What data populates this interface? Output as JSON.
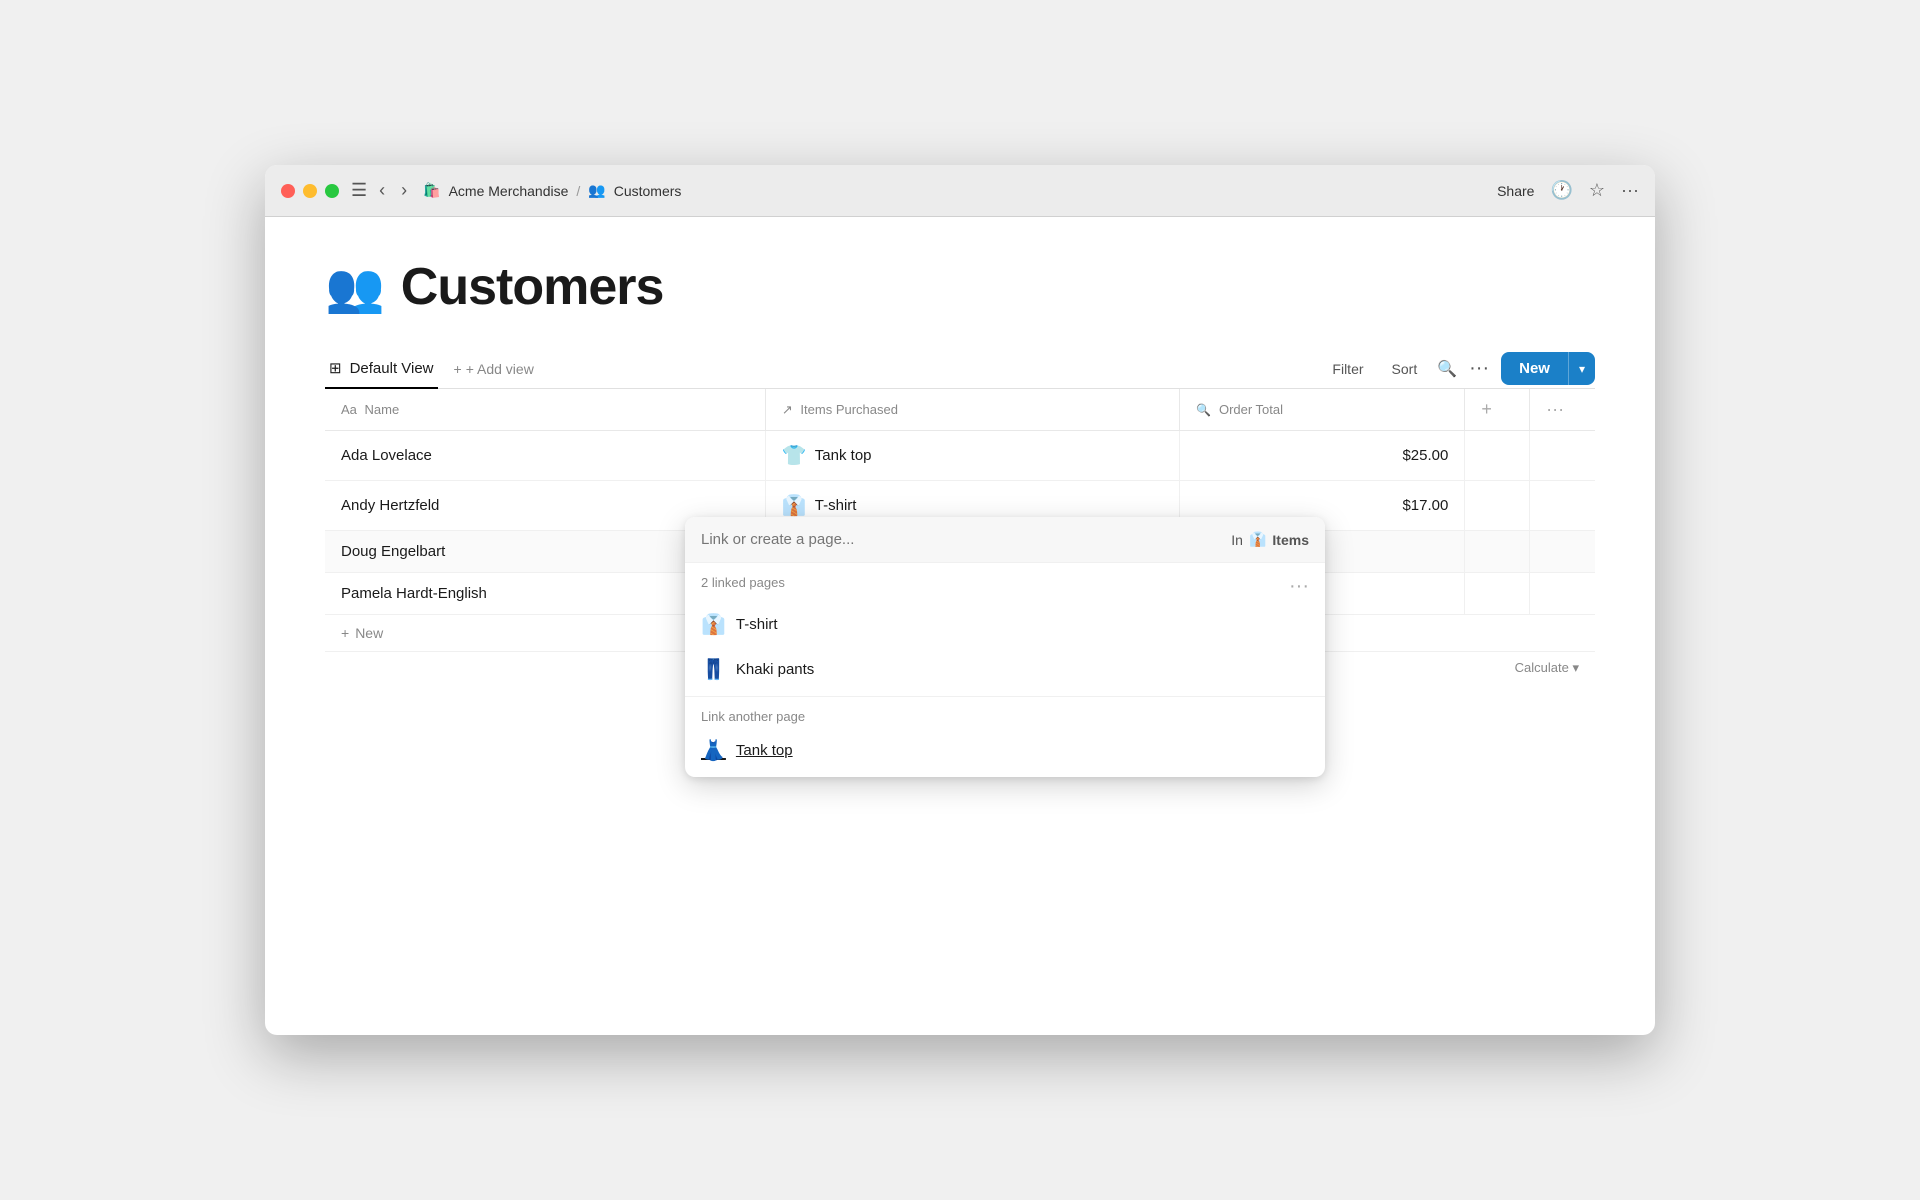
{
  "window": {
    "title": "Customers"
  },
  "titlebar": {
    "app_name": "Acme Merchandise",
    "app_icon": "🛍️",
    "separator": "/",
    "page_name": "Customers",
    "page_icon": "👥",
    "share_label": "Share",
    "history_icon": "🕐",
    "star_icon": "☆",
    "more_icon": "···"
  },
  "page": {
    "icon": "👥",
    "title": "Customers"
  },
  "views": {
    "default_view_label": "Default View",
    "default_view_icon": "⊞",
    "add_view_label": "+ Add view"
  },
  "toolbar": {
    "filter_label": "Filter",
    "sort_label": "Sort",
    "search_icon": "🔍",
    "more_icon": "···",
    "new_label": "New",
    "new_arrow": "▾"
  },
  "table": {
    "columns": [
      {
        "id": "name",
        "icon": "Aa",
        "label": "Name"
      },
      {
        "id": "items",
        "icon": "↗",
        "label": "Items Purchased"
      },
      {
        "id": "order",
        "icon": "🔍",
        "label": "Order Total"
      }
    ],
    "rows": [
      {
        "name": "Ada Lovelace",
        "item_icon": "👕",
        "item_label": "Tank top",
        "order_total": "$25.00"
      },
      {
        "name": "Andy Hertzfeld",
        "item_icon": "👔",
        "item_label": "T-shirt",
        "order_total": "$17.00"
      },
      {
        "name": "Doug Engelbart",
        "item_icon": "",
        "item_label": "",
        "order_total": ""
      },
      {
        "name": "Pamela Hardt-English",
        "item_icon": "",
        "item_label": "",
        "order_total": ""
      }
    ],
    "new_row_label": "New",
    "calculate_label": "Calculate"
  },
  "popup": {
    "search_placeholder": "Link or create a page...",
    "in_label": "In",
    "in_icon": "👔",
    "in_text": "Items",
    "linked_pages_label": "2 linked pages",
    "linked_pages": [
      {
        "icon": "👔",
        "label": "T-shirt"
      },
      {
        "icon": "👖",
        "label": "Khaki pants"
      }
    ],
    "link_another_label": "Link another page",
    "link_another_pages": [
      {
        "icon": "👗",
        "label": "Tank top"
      }
    ]
  }
}
